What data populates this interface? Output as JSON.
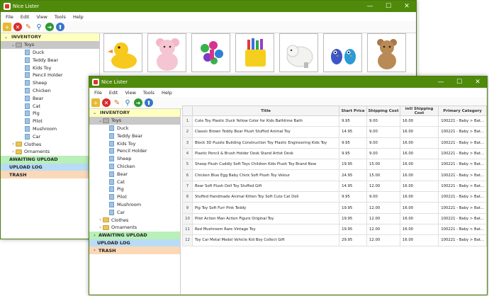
{
  "app": {
    "title": "Nice Lister",
    "menu": [
      "File",
      "Edit",
      "View",
      "Tools",
      "Help"
    ],
    "window_controls": [
      "—",
      "☐",
      "✕"
    ]
  },
  "tree": {
    "inventory": "INVENTORY",
    "toys": "Toys",
    "items": [
      "Duck",
      "Teddy Bear",
      "Kids Toy",
      "Pencil Holder",
      "Sheep",
      "Chicken",
      "Bear",
      "Cat",
      "Pig",
      "Pilot",
      "Mushroom",
      "Car"
    ],
    "clothes": "Clothes",
    "ornaments": "Ornaments",
    "awaiting_upload": "AWAITING UPLOAD",
    "upload_log": "UPLOAD LOG",
    "trash": "TRASH",
    "expanded_glyph": "⌄",
    "collapsed_glyph": "›"
  },
  "toolbar_icons": [
    "add-folder-icon",
    "delete-icon",
    "edit-icon",
    "search-icon",
    "export-icon",
    "upload-icon"
  ],
  "thumbnails": [
    "duck",
    "teddy-bear",
    "kids-toy",
    "pencil-holder",
    "sheep",
    "chicken",
    "bear"
  ],
  "table": {
    "headers": [
      "",
      "Title",
      "Start Price",
      "Shipping Cost",
      "intl Shipping Cost",
      "Primary Category"
    ],
    "rows": [
      [
        "1",
        "Cute Toy Plastic Duck Yellow Color for Kids Bathtime Bath",
        "9.95",
        "9.00",
        "16.00",
        "100221 - Baby > Bat..."
      ],
      [
        "2",
        " Classic Brown Teddy Bear Plush Stuffed Animal Toy",
        "14.95",
        "9.00",
        "16.00",
        "100221 - Baby > Bat..."
      ],
      [
        "3",
        "Block 3D Puzzle Building Construction Toy Plastic Engineering Kids Toy",
        "9.95",
        "9.00",
        "16.00",
        "100221 - Baby > Bat..."
      ],
      [
        "4",
        "Plastic Pencil & Brush Holder Desk Stand Artist Desk",
        "9.95",
        "9.00",
        "16.00",
        "100221 - Baby > Bat..."
      ],
      [
        "5",
        "Sheep Plush Cuddly Soft Toys Children Kids Plush Toy Brand New",
        "19.95",
        "15.00",
        "16.00",
        "100221 - Baby > Bat..."
      ],
      [
        "6",
        "Chicken Blue Egg Baby Chick Soft Plush Toy Velour",
        "24.95",
        "15.00",
        "16.00",
        "100221 - Baby > Bat..."
      ],
      [
        "7",
        "Bear Soft Plush Doll Toy Stuffed Gift",
        "14.95",
        "12.00",
        "16.00",
        "100221 - Baby > Bat..."
      ],
      [
        "8",
        "Stuffed Handmade Animal Kitten Toy Soft Cute Cat Doll",
        "9.95",
        "9.00",
        "16.00",
        "100221 - Baby > Bat..."
      ],
      [
        "9",
        "Pig Toy Soft Furr Pink Teddy",
        "19.95",
        "12.00",
        "16.00",
        "100221 - Baby > Bat..."
      ],
      [
        "10",
        "Pilot Action Man Action Figure Original Toy",
        "19.95",
        "12.00",
        "16.00",
        "100221 - Baby > Bat..."
      ],
      [
        "11",
        "Red Mushroom Rare Vintage Toy",
        "19.95",
        "12.00",
        "16.00",
        "100221 - Baby > Bat..."
      ],
      [
        "12",
        "Toy Car Metal Model Vehicle Kid Boy Collect Gift",
        "29.95",
        "12.00",
        "16.00",
        "100221 - Baby > Bat..."
      ]
    ]
  }
}
